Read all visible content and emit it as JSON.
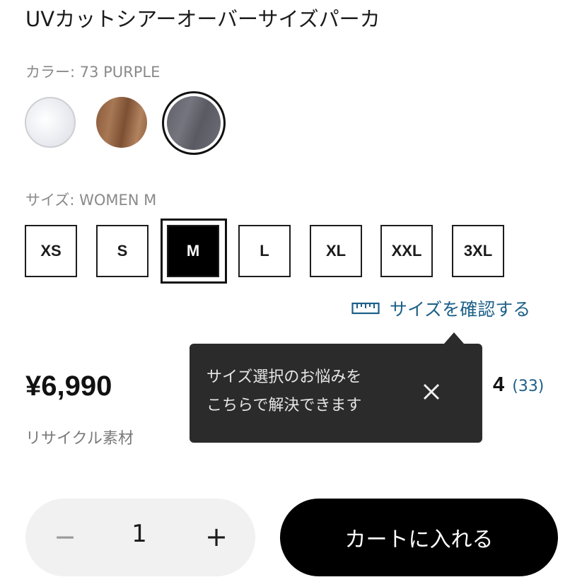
{
  "product": {
    "title": "UVカットシアーオーバーサイズパーカ",
    "color_label": "カラー: 73 PURPLE",
    "colors": [
      {
        "name": "white",
        "hex": "#eef0f4"
      },
      {
        "name": "brown",
        "hex": "#9a6b4a"
      },
      {
        "name": "purple",
        "hex": "#6a6b73",
        "selected": true
      }
    ],
    "size_label": "サイズ: WOMEN M",
    "sizes": [
      "XS",
      "S",
      "M",
      "L",
      "XL",
      "XXL",
      "3XL"
    ],
    "selected_size": "M",
    "size_guide_link": "サイズを確認する",
    "price": "¥6,990",
    "material_note": "リサイクル素材",
    "rating_value": "4",
    "review_count": "(33)"
  },
  "tooltip": {
    "line1": "サイズ選択のお悩みを",
    "line2": "こちらで解決できます"
  },
  "purchase": {
    "quantity": "1",
    "minus_symbol": "−",
    "plus_symbol": "+",
    "add_to_cart_label": "カートに入れる"
  },
  "theme": {
    "link_color": "#1c5f88",
    "tooltip_bg": "#2b2b2b",
    "primary_button_bg": "#000000"
  },
  "icons": [
    "ruler-icon",
    "close-icon"
  ]
}
